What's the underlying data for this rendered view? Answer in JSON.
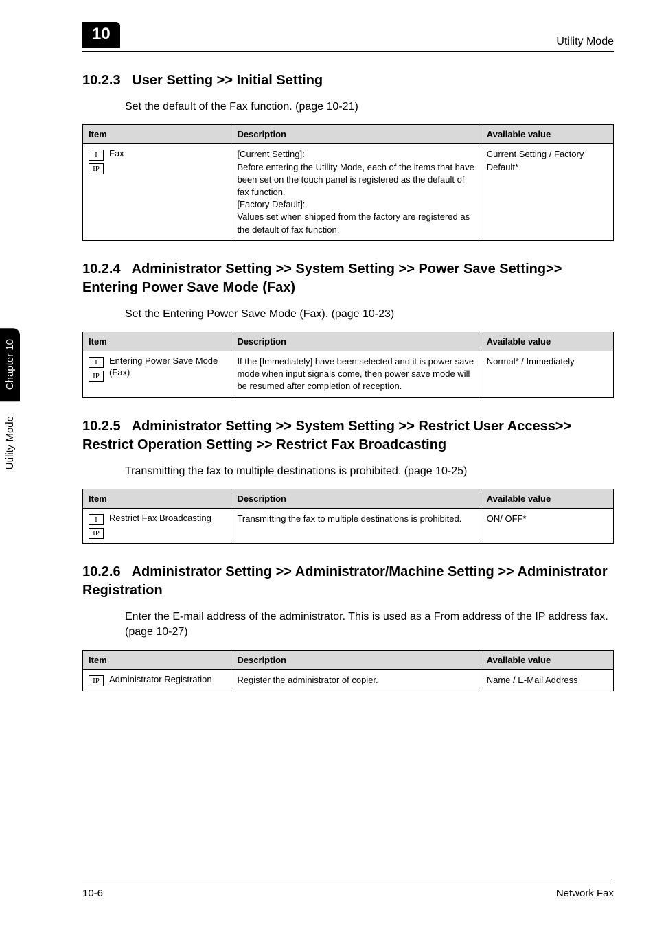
{
  "header": {
    "chapter_number": "10",
    "utility_label": "Utility Mode"
  },
  "side": {
    "chapter_label": "Chapter 10",
    "mode_label": "Utility Mode"
  },
  "footer": {
    "page_number": "10-6",
    "doc_title": "Network Fax"
  },
  "icons": {
    "i": "I",
    "ip": "IP"
  },
  "sections": [
    {
      "num": "10.2.3",
      "title": "User Setting >> Initial Setting",
      "intro": "Set the default of the Fax function. (page 10-21)",
      "show_i": true,
      "show_ip": true,
      "table": {
        "headers": {
          "item": "Item",
          "desc": "Description",
          "avail": "Available value"
        },
        "row": {
          "item_label": "Fax",
          "desc": "[Current Setting]:\nBefore entering the Utility Mode, each of the items that have been set on the touch panel is registered as the default of fax function.\n[Factory Default]:\nValues set when shipped from the factory are registered as the default of fax function.",
          "avail": "Current Setting / Factory Default*"
        }
      }
    },
    {
      "num": "10.2.4",
      "title": "Administrator Setting >> System Setting >> Power Save Setting>> Entering Power Save Mode (Fax)",
      "intro": "Set the Entering Power Save Mode (Fax). (page 10-23)",
      "show_i": true,
      "show_ip": true,
      "table": {
        "headers": {
          "item": "Item",
          "desc": "Description",
          "avail": "Available value"
        },
        "row": {
          "item_label": "Entering Power Save Mode (Fax)",
          "desc": "If the [Immediately] have been selected and it is power save mode when input signals come, then power save mode will be resumed after completion of reception.",
          "avail": "Normal* / Immediately"
        }
      }
    },
    {
      "num": "10.2.5",
      "title": "Administrator Setting >> System Setting >> Restrict User Access>> Restrict Operation Setting >> Restrict Fax Broadcasting",
      "intro": "Transmitting the fax to multiple destinations is prohibited. (page 10-25)",
      "show_i": true,
      "show_ip": true,
      "table": {
        "headers": {
          "item": "Item",
          "desc": "Description",
          "avail": "Available value"
        },
        "row": {
          "item_label": "Restrict Fax Broadcasting",
          "desc": "Transmitting the fax to multiple destinations is prohibited.",
          "avail": "ON/ OFF*"
        }
      }
    },
    {
      "num": "10.2.6",
      "title": "Administrator Setting >> Administrator/Machine Setting >> Administrator Registration",
      "intro": "Enter the E-mail address of the administrator. This is used as a From address of the IP address fax. (page 10-27)",
      "show_i": false,
      "show_ip": true,
      "table": {
        "headers": {
          "item": "Item",
          "desc": "Description",
          "avail": "Available value"
        },
        "row": {
          "item_label": "Administrator Registration",
          "desc": "Register the administrator of copier.",
          "avail": "Name / E-Mail Address"
        }
      }
    }
  ]
}
